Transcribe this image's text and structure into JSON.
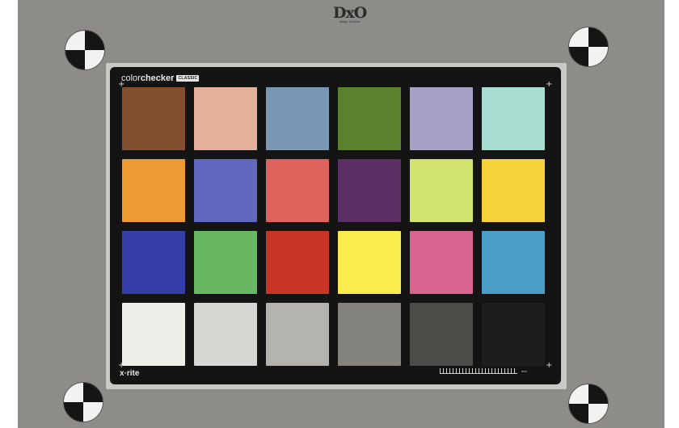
{
  "logo": {
    "main": "DxO",
    "sub": "Image Science"
  },
  "card": {
    "brand_prefix": "color",
    "brand_name": "checker",
    "brand_badge": "CLASSIC",
    "maker": "x·rite",
    "ruler_label": "mm"
  },
  "patches": [
    {
      "name": "dark-skin",
      "color": "#82502f"
    },
    {
      "name": "light-skin",
      "color": "#e4b09c"
    },
    {
      "name": "blue-sky",
      "color": "#7a96b5"
    },
    {
      "name": "foliage",
      "color": "#5b832f"
    },
    {
      "name": "blue-flower",
      "color": "#a7a2c5"
    },
    {
      "name": "bluish-green",
      "color": "#a7dcd0"
    },
    {
      "name": "orange",
      "color": "#ee9b33"
    },
    {
      "name": "purplish-blue",
      "color": "#6069bf"
    },
    {
      "name": "moderate-red",
      "color": "#e0625d"
    },
    {
      "name": "purple",
      "color": "#5b2f63"
    },
    {
      "name": "yellow-green",
      "color": "#d2e26f"
    },
    {
      "name": "orange-yellow",
      "color": "#f6d33a"
    },
    {
      "name": "blue",
      "color": "#343da8"
    },
    {
      "name": "green",
      "color": "#68b863"
    },
    {
      "name": "red",
      "color": "#c93626"
    },
    {
      "name": "yellow",
      "color": "#f9ec4d"
    },
    {
      "name": "magenta",
      "color": "#d8638f"
    },
    {
      "name": "cyan",
      "color": "#489ec8"
    },
    {
      "name": "white",
      "color": "#efefea"
    },
    {
      "name": "neutral-8",
      "color": "#d6d6d2"
    },
    {
      "name": "neutral-6-5",
      "color": "#b4b3ae"
    },
    {
      "name": "neutral-5",
      "color": "#84837e"
    },
    {
      "name": "neutral-3-5",
      "color": "#4b4c48"
    },
    {
      "name": "black",
      "color": "#1d1d1d"
    }
  ],
  "colors": {
    "background": "#8d8c88",
    "card": "#141414",
    "mount": "#c9c8c4"
  }
}
